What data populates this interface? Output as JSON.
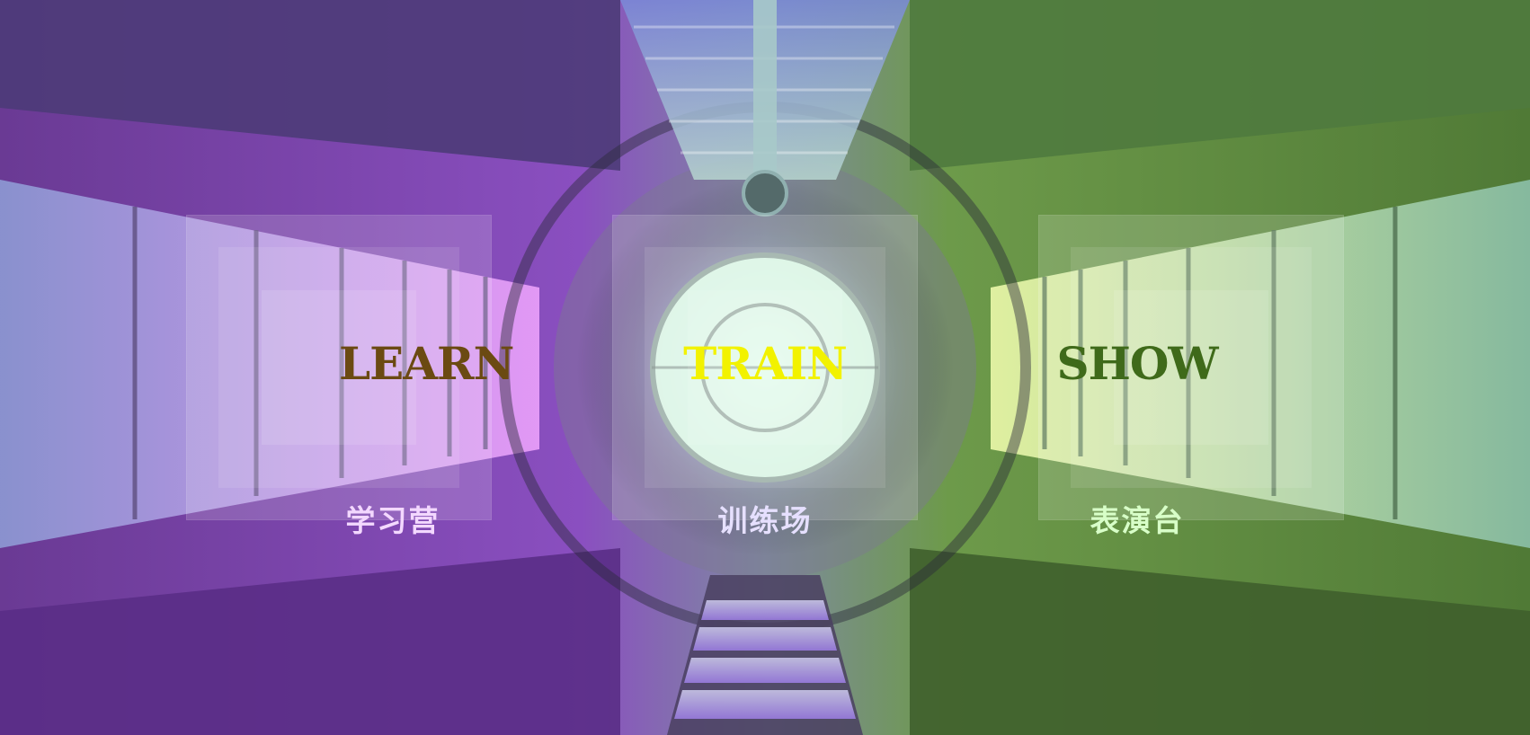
{
  "menu": {
    "learn": {
      "label": "LEARN",
      "subtitle": "学习营",
      "label_color": "#6b4a12",
      "subtitle_color": "#f3d8ff"
    },
    "train": {
      "label": "TRAIN",
      "subtitle": "训练场",
      "label_color": "#f2f200",
      "subtitle_color": "#e6e0ff"
    },
    "show": {
      "label": "SHOW",
      "subtitle": "表演台",
      "label_color": "#3f6a1a",
      "subtitle_color": "#d8ffc8"
    }
  },
  "colors": {
    "tunnel_left": "#7b3fa6",
    "tunnel_right": "#5f8a3a",
    "tunnel_center": "#b9d6c9"
  }
}
